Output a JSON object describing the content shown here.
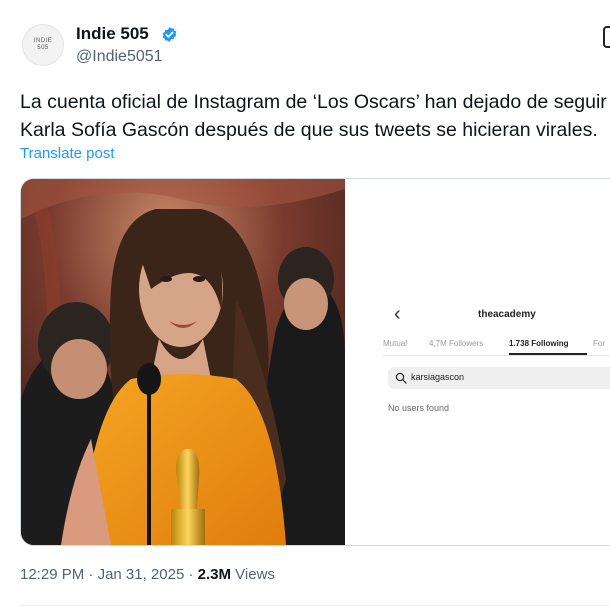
{
  "author": {
    "name": "Indie 505",
    "handle": "@Indie5051",
    "avatar_text_line1": "INDIE",
    "avatar_text_line2": "505",
    "verified": true
  },
  "tweet": {
    "line1": "La cuenta oficial de Instagram de ‘Los Oscars’ han dejado de seguir a",
    "line2": "Karla Sofía Gascón después de que sus tweets se hicieran virales.",
    "translate_label": "Translate post"
  },
  "instagram": {
    "account": "theacademy",
    "tabs": [
      {
        "label": "Mutual"
      },
      {
        "label": "4,7M Followers"
      },
      {
        "label": "1.738 Following"
      },
      {
        "label": "For"
      }
    ],
    "active_tab": 2,
    "search_value": "karsiagascon",
    "empty_text": "No users found"
  },
  "meta": {
    "time": "12:29 PM",
    "sep1": " · ",
    "date": "Jan 31, 2025",
    "sep2": " · ",
    "views": "2.3M",
    "views_label": " Views"
  },
  "colors": {
    "accent": "#1d9bf0",
    "text": "#0f1419",
    "muted": "#536471"
  }
}
